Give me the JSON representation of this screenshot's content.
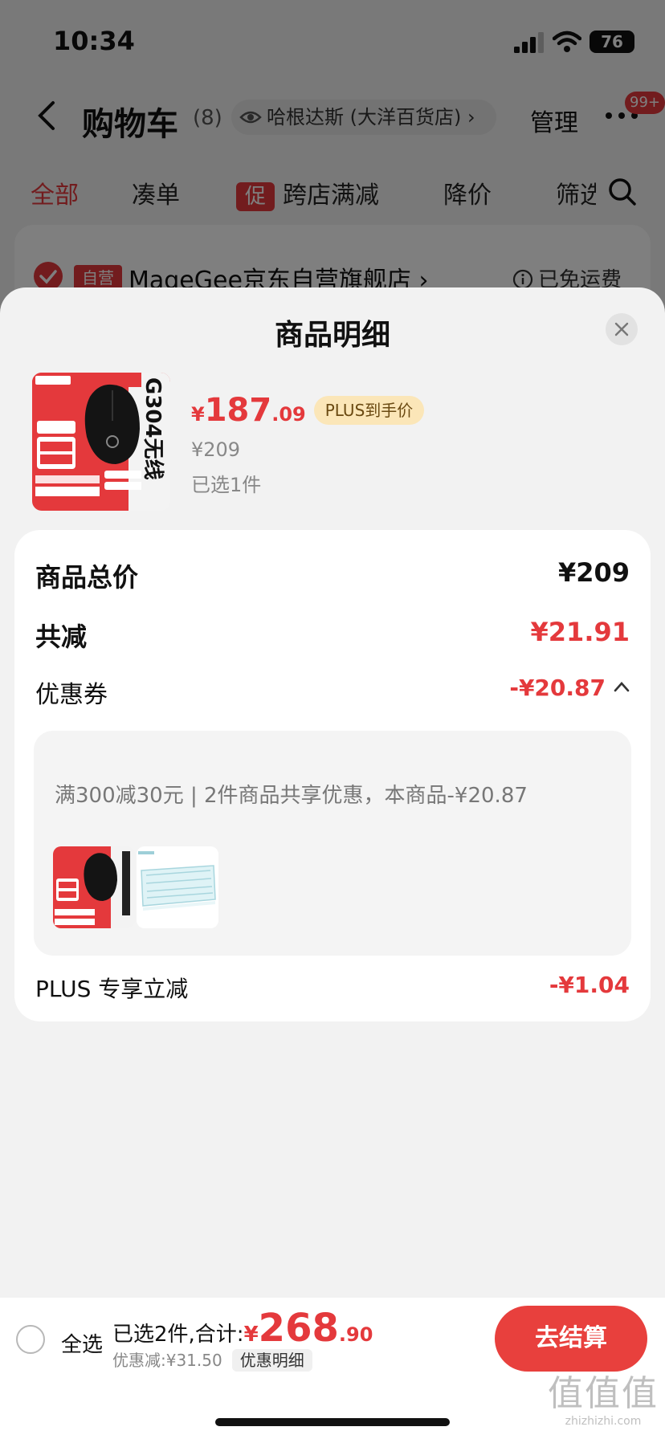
{
  "status_bar": {
    "time": "10:34",
    "battery": "76"
  },
  "nav": {
    "title": "购物车",
    "count": "(8)",
    "store_pill": "哈根达斯 (大洋百货店) ›",
    "manage_label": "管理",
    "badge": "99+"
  },
  "tabs": [
    "全部",
    "凑单",
    "跨店满减",
    "降价",
    "筛选"
  ],
  "promo_tag": "促",
  "shop": {
    "self_tag": "自营",
    "name": "MageGee京东自营旗舰店 ›",
    "shipping": "已免运费"
  },
  "sheet": {
    "title": "商品明细",
    "product": {
      "image_text": "G304无线",
      "yen": "¥",
      "price_int": "187",
      "price_dec": ".09",
      "plus_badge": "PLUS到手价",
      "original_price": "¥209",
      "selected_count": "已选1件"
    },
    "rows": {
      "total_label": "商品总价",
      "total_value": "¥209",
      "reduce_label": "共减",
      "reduce_value": "¥21.91",
      "coupon_label": "优惠券",
      "coupon_value": "-¥20.87",
      "plus_label": "PLUS 专享立减",
      "plus_value": "-¥1.04"
    },
    "coupon_detail": "满300减30元 | 2件商品共享优惠，本商品-¥20.87"
  },
  "checkout": {
    "select_all": "全选",
    "selected_total_label": "已选2件,合计:",
    "yen": "¥",
    "total_int": "268",
    "total_dec": ".90",
    "discount": "优惠减:¥31.50",
    "detail_link": "优惠明细",
    "button": "去结算"
  },
  "watermark": {
    "big": "值值值",
    "small": "zhizhizhi.com"
  },
  "colors": {
    "accent": "#e4393c",
    "plus_pill": "#fbe6b8"
  },
  "icons": [
    "signal-icon",
    "wifi-icon",
    "back-icon",
    "eye-icon",
    "more-icon",
    "search-icon",
    "check-icon",
    "info-icon",
    "close-icon",
    "chevron-up-icon"
  ]
}
